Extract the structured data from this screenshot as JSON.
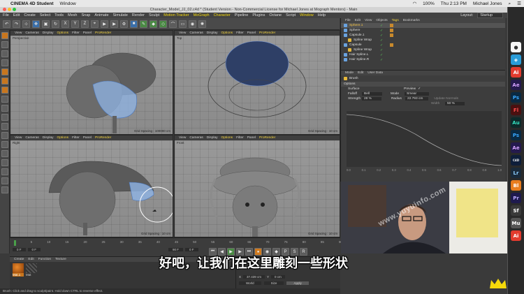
{
  "mac_bar": {
    "app_name": "CINEMA 4D Student",
    "window_menu": "Window",
    "wifi_icon": "wifi-icon",
    "battery": "100%",
    "clock": "Thu 2:13 PM",
    "user": "Michael Jones"
  },
  "title_bar": {
    "text": "Character_Model_JJ_02.c4d * (Student Version - Non-Commercial License for Michael Jones at Mograph Mentors) - Main"
  },
  "menu": {
    "items": [
      "File",
      "Edit",
      "Create",
      "Select",
      "Tools",
      "Mesh",
      "Snap",
      "Animate",
      "Simulate",
      "Render",
      "Sculpt",
      "Motion Tracker",
      "MoGraph",
      "Character",
      "Pipeline",
      "Plugins",
      "Octane",
      "Script",
      "Window",
      "Help"
    ],
    "layout_label": "Layout:",
    "layout_value": "Startup"
  },
  "viewports": [
    {
      "name": "Perspective",
      "menu": [
        "View",
        "Cameras",
        "Display",
        "Options",
        "Filter",
        "Panel",
        "ProRender"
      ],
      "grid": "Grid Spacing : 100000 cm"
    },
    {
      "name": "Top",
      "menu": [
        "View",
        "Cameras",
        "Display",
        "Options",
        "Filter",
        "Panel",
        "ProRender"
      ],
      "grid": "Grid Spacing : 10 cm"
    },
    {
      "name": "Right",
      "menu": [
        "View",
        "Cameras",
        "Display",
        "Options",
        "Filter",
        "Panel",
        "ProRender"
      ],
      "grid": "Grid Spacing : 10 cm"
    },
    {
      "name": "Front",
      "menu": [
        "View",
        "Cameras",
        "Display",
        "Options",
        "Filter",
        "Panel",
        "ProRender"
      ],
      "grid": "Grid Spacing : 10 cm"
    }
  ],
  "timeline": {
    "ticks": [
      "0",
      "5",
      "10",
      "15",
      "20",
      "25",
      "30",
      "35",
      "40",
      "45",
      "50",
      "55",
      "60",
      "65",
      "70",
      "75",
      "80",
      "85",
      "90"
    ],
    "frame_start": "0 F",
    "frame_current": "0 F",
    "frame_end": "90 F",
    "frame_right": "0 F"
  },
  "material_panel": {
    "menu": [
      "Create",
      "Edit",
      "Function",
      "Texture"
    ],
    "materials": [
      "Mat.1",
      "Mat"
    ]
  },
  "coords_panel": {
    "x_label": "X",
    "x_value": "37.439 cm",
    "y_label": "Y",
    "y_value": "0 cm",
    "world": "World",
    "size": "Size",
    "apply": "Apply"
  },
  "status": "Brush: Click and drag to sculpt/paint. Hold down CTRL to reverse effect.",
  "object_manager": {
    "menu": [
      "File",
      "Edit",
      "View",
      "Objects",
      "Tags",
      "Bookmarks"
    ],
    "objects": [
      {
        "name": "Sphere.1",
        "selected": true
      },
      {
        "name": "Sphere",
        "selected": false
      },
      {
        "name": "Capsule.1",
        "selected": false
      },
      {
        "name": "Spline Wrap",
        "selected": false
      },
      {
        "name": "Capsule",
        "selected": false
      },
      {
        "name": "Spline Wrap",
        "selected": false
      },
      {
        "name": "Hair Spline.L",
        "selected": false
      },
      {
        "name": "Hair Spline.R",
        "selected": false
      }
    ]
  },
  "attribute_manager": {
    "menu": [
      "Mode",
      "Edit",
      "User Data"
    ],
    "tool_name": "Brush",
    "section": "Options",
    "surface": "Surface",
    "preview": "Preview",
    "falloff_label": "Falloff",
    "falloff_value": "Bell",
    "mode_label": "Mode",
    "mode_value": "Smear",
    "strength_label": "Strength",
    "strength_value": "28 %",
    "radius_label": "Radius",
    "radius_value": "22.793 cm",
    "update_normals": "Update Normals",
    "width_label": "Width",
    "width_value": "50 %",
    "curve_ticks": [
      "0.0",
      "0.1",
      "0.2",
      "0.3",
      "0.4",
      "0.5",
      "0.6",
      "0.7",
      "0.8",
      "0.9",
      "1.0"
    ]
  },
  "dock": {
    "icons": [
      "Ai",
      "Ae",
      "Ps",
      "Fl",
      "Au",
      "Ps",
      "Ae",
      "C4D",
      "Lr",
      "Bl",
      "Pr",
      "Sf",
      "Mu",
      "Ai"
    ]
  },
  "subtitle": "好吧，让我们在这里雕刻一些形状",
  "watermark": "www.yuyuinfo.com"
}
